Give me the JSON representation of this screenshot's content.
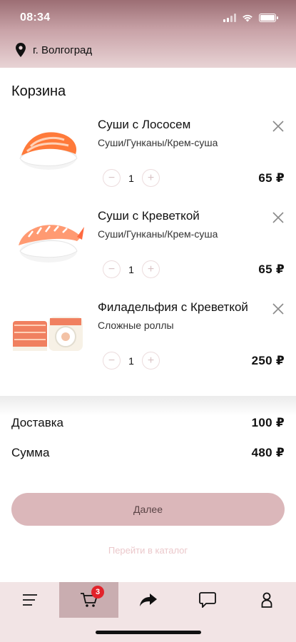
{
  "status_bar": {
    "time": "08:34"
  },
  "location": {
    "city": "г. Волгоград"
  },
  "cart": {
    "title": "Корзина",
    "items": [
      {
        "name": "Суши с Лососем",
        "category": "Суши/Гунканы/Крем-суша",
        "quantity": "1",
        "price": "65 ₽",
        "image": "salmon-sushi-image"
      },
      {
        "name": "Суши с Креветкой",
        "category": "Суши/Гунканы/Крем-суша",
        "quantity": "1",
        "price": "65 ₽",
        "image": "shrimp-sushi-image"
      },
      {
        "name": "Филадельфия с Креветкой",
        "category": "Сложные роллы",
        "quantity": "1",
        "price": "250 ₽",
        "image": "philadelphia-roll-image"
      }
    ],
    "minus": "−",
    "plus": "+"
  },
  "summary": {
    "delivery_label": "Доставка",
    "delivery_value": "100 ₽",
    "total_label": "Сумма",
    "total_value": "480 ₽"
  },
  "actions": {
    "next_label": "Далее",
    "catalog_link": "Перейти в каталог"
  },
  "bottom_nav": {
    "cart_badge": "3",
    "icons": [
      "menu-icon",
      "cart-icon",
      "share-icon",
      "chat-icon",
      "profile-icon"
    ]
  },
  "colors": {
    "accent": "#dbb7ba",
    "header_top": "#9c6e74",
    "badge": "#e2222a",
    "nav_bg": "#f2e4e5",
    "nav_active": "#c9adb0"
  }
}
